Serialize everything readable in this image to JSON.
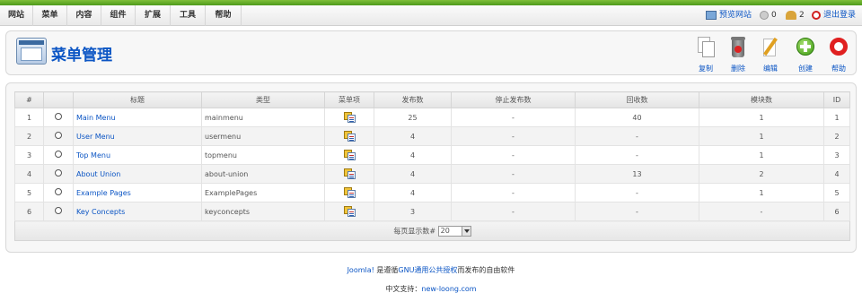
{
  "top_menu": [
    "网站",
    "菜单",
    "内容",
    "组件",
    "扩展",
    "工具",
    "帮助"
  ],
  "status": {
    "preview": "预览网站",
    "messages": "0",
    "users": "2",
    "logout": "退出登录"
  },
  "page_title": "菜单管理",
  "toolbar": {
    "copy": "复制",
    "delete": "删除",
    "edit": "编辑",
    "new": "创建",
    "help": "帮助"
  },
  "table": {
    "headers": {
      "num": "#",
      "title": "标题",
      "type": "类型",
      "menu_items": "菜单项",
      "published": "发布数",
      "unpublished": "停止发布数",
      "trashed": "回收数",
      "modules": "模块数",
      "id": "ID"
    },
    "rows": [
      {
        "num": "1",
        "title": "Main Menu",
        "type": "mainmenu",
        "published": "25",
        "unpublished": "-",
        "trashed": "40",
        "modules": "1",
        "id": "1"
      },
      {
        "num": "2",
        "title": "User Menu",
        "type": "usermenu",
        "published": "4",
        "unpublished": "-",
        "trashed": "-",
        "modules": "1",
        "id": "2"
      },
      {
        "num": "3",
        "title": "Top Menu",
        "type": "topmenu",
        "published": "4",
        "unpublished": "-",
        "trashed": "-",
        "modules": "1",
        "id": "3"
      },
      {
        "num": "4",
        "title": "About Union",
        "type": "about-union",
        "published": "4",
        "unpublished": "-",
        "trashed": "13",
        "modules": "2",
        "id": "4"
      },
      {
        "num": "5",
        "title": "Example Pages",
        "type": "ExamplePages",
        "published": "4",
        "unpublished": "-",
        "trashed": "-",
        "modules": "1",
        "id": "5"
      },
      {
        "num": "6",
        "title": "Key Concepts",
        "type": "keyconcepts",
        "published": "3",
        "unpublished": "-",
        "trashed": "-",
        "modules": "-",
        "id": "6"
      }
    ],
    "pager_label": "每页显示数#",
    "pager_value": "20"
  },
  "footer": {
    "joomla": "Joomla!",
    "text1": " 是遵循",
    "license": "GNU通用公共授权",
    "text2": "而发布的自由软件",
    "support_label": "中文支持：",
    "support_site": "new-loong.com"
  }
}
